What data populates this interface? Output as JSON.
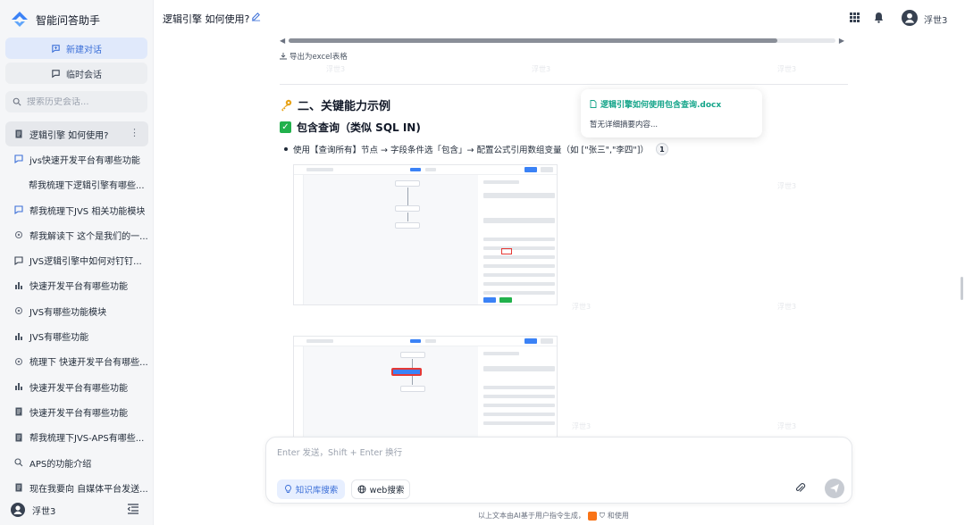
{
  "app": {
    "title": "智能问答助手"
  },
  "sidebar": {
    "new_chat": "新建对话",
    "temp_chat": "临时会话",
    "search_placeholder": "搜索历史会话...",
    "history": [
      {
        "label": "逻辑引擎 如何使用?",
        "icon": "document-icon",
        "active": true
      },
      {
        "label": "jvs快速开发平台有哪些功能",
        "icon": "chat-ai-icon"
      },
      {
        "label": "帮我梳理下逻辑引擎有哪些...",
        "icon": ""
      },
      {
        "label": "帮我梳理下JVS 相关功能模块",
        "icon": "chat-ai-icon"
      },
      {
        "label": "帮我解读下 这个是我们的一...",
        "icon": "gear-icon"
      },
      {
        "label": "JVS逻辑引擎中如何对钉钉...",
        "icon": "chat-icon"
      },
      {
        "label": "快速开发平台有哪些功能",
        "icon": "bar-chart-icon"
      },
      {
        "label": "JVS有哪些功能模块",
        "icon": "gear-icon"
      },
      {
        "label": "JVS有哪些功能",
        "icon": "bar-chart-icon"
      },
      {
        "label": "梳理下 快速开发平台有哪些...",
        "icon": "gear-icon"
      },
      {
        "label": "快速开发平台有哪些功能",
        "icon": "bar-chart-icon"
      },
      {
        "label": "快速开发平台有哪些功能",
        "icon": "document-icon"
      },
      {
        "label": "帮我梳理下JVS-APS有哪些...",
        "icon": "document-icon"
      },
      {
        "label": "APS的功能介绍",
        "icon": "search-icon"
      },
      {
        "label": "现在我要向 自媒体平台发送...",
        "icon": "document-icon"
      }
    ],
    "footer_user": "浮世3"
  },
  "topbar": {
    "title": "逻辑引擎 如何使用?",
    "user": "浮世3"
  },
  "content": {
    "export_label": "导出为excel表格",
    "h2": "二、关键能力示例",
    "h3": "包含查询（类似 SQL IN)",
    "bullet": "使用【查询所有】节点 → 字段条件选「包含」→ 配置公式引用数组变量（如 [\"张三\",\"李四\"]）",
    "cite": "1",
    "watermark": "浮世3"
  },
  "popup": {
    "title": "逻辑引擎如何使用包含查询.docx",
    "body": "暂无详细摘要内容..."
  },
  "composer": {
    "placeholder": "Enter 发送，Shift + Enter 换行",
    "chip_kb": "知识库搜索",
    "chip_web": "web搜索"
  },
  "footer": {
    "disclaimer_a": "以上文本由AI基于用户指令生成，",
    "disclaimer_b": "和使用"
  },
  "colors": {
    "accent": "#3b6fd8",
    "green": "#15a58a",
    "sidebar_bg": "#f5f6f8"
  }
}
